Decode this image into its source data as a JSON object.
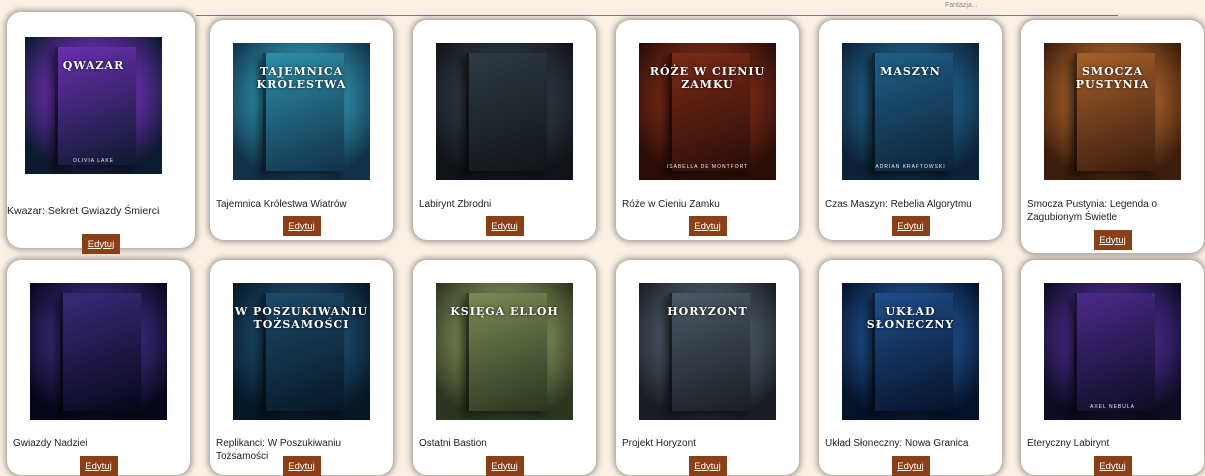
{
  "header": {
    "faint_text": "Fantazja..."
  },
  "edit_label": "Edytuj",
  "books": [
    {
      "title": "Kwazar: Sekret Gwiazdy Śmierci",
      "cover_text": "QWAZAR",
      "cover_author": "OLIVIA LAKE",
      "colors": [
        "#0b1a2e",
        "#6b2fb0",
        "#f2a23a"
      ]
    },
    {
      "title": "Tajemnica Królestwa Wiatrów",
      "cover_text": "TAJEMNICA KRÓLESTWA",
      "cover_author": "",
      "colors": [
        "#12314a",
        "#2e8fa8",
        "#c9a54a"
      ]
    },
    {
      "title": "Labirynt Zbrodni",
      "cover_text": "",
      "cover_author": "",
      "colors": [
        "#101419",
        "#2f3a42",
        "#6d7c85"
      ]
    },
    {
      "title": "Róże w Cieniu Zamku",
      "cover_text": "RÓŻE W CIENIU ZAMKU",
      "cover_author": "ISABELLA DE MONTFORT",
      "colors": [
        "#2a0d08",
        "#7a2a16",
        "#e08c4a"
      ]
    },
    {
      "title": "Czas Maszyn: Rebelia Algorytmu",
      "cover_text": "MASZYN",
      "cover_author": "ADRIAN KRAFTOWSKI",
      "colors": [
        "#0d2238",
        "#1f5f86",
        "#8fd2ef"
      ]
    },
    {
      "title": "Smocza Pustynia: Legenda o Zagubionym Świetle",
      "cover_text": "SMOCZA PUSTYNIA",
      "cover_author": "",
      "colors": [
        "#3b1c0d",
        "#a5602a",
        "#2fa8a0"
      ]
    },
    {
      "title": "Gwiazdy Nadziei",
      "cover_text": "",
      "cover_author": "",
      "colors": [
        "#06071a",
        "#3a2a7a",
        "#4aa6d9"
      ]
    },
    {
      "title": "Replikanci: W Poszukiwaniu Tożsamości",
      "cover_text": "W POSZUKIWANIU TOŻSAMOŚCI",
      "cover_author": "",
      "colors": [
        "#061726",
        "#1d4a6a",
        "#6fd0ff"
      ]
    },
    {
      "title": "Ostatni Bastion",
      "cover_text": "KSIĘGA ELLOH",
      "cover_author": "",
      "colors": [
        "#2b3520",
        "#7b8a55",
        "#d8c08a"
      ]
    },
    {
      "title": "Projekt Horyzont",
      "cover_text": "HORYZONT",
      "cover_author": "",
      "colors": [
        "#1a1e24",
        "#4d5965",
        "#e9b98a"
      ]
    },
    {
      "title": "Układ Słoneczny: Nowa Granica",
      "cover_text": "UKŁAD SŁONECZNY",
      "cover_author": "",
      "colors": [
        "#06122a",
        "#1f4e8a",
        "#f0a24a"
      ]
    },
    {
      "title": "Eteryczny Labirynt",
      "cover_text": "",
      "cover_author": "AXEL NEBULA",
      "colors": [
        "#0c0c22",
        "#4a2a8a",
        "#d04aa0"
      ]
    }
  ]
}
